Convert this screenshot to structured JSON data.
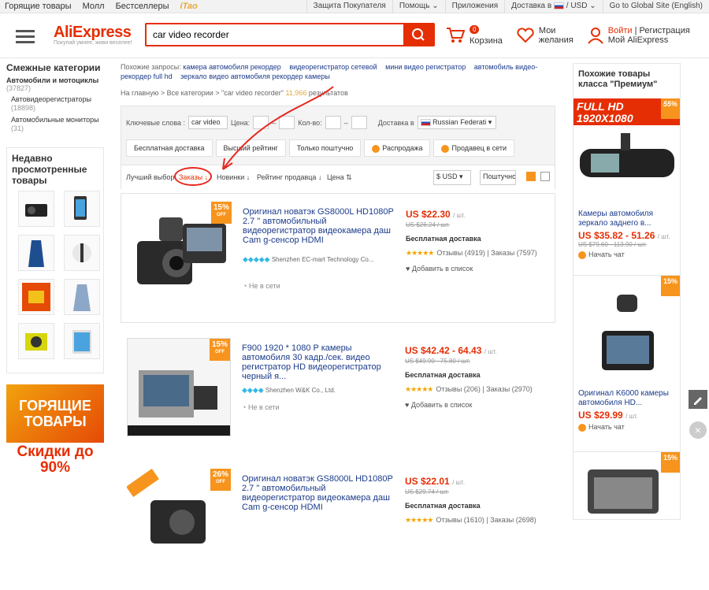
{
  "topbar": {
    "left": [
      "Горящие товары",
      "Молл",
      "Бестселлеры",
      "iTao"
    ],
    "right": [
      "Защита Покупателя",
      "Помощь",
      "Приложения",
      "Доставка в",
      "/ USD",
      "Go to Global Site (English)"
    ]
  },
  "header": {
    "logo": "AliExpress",
    "tagline": "Покупай умнее, живи веселее!",
    "search_value": "car video recorder",
    "cart_label": "Корзина",
    "cart_count": "0",
    "wish_label1": "Мои",
    "wish_label2": "желания",
    "login": "Войти",
    "register": "Регистрация",
    "my": "Мой AliExpress"
  },
  "left": {
    "related_title": "Смежные категории",
    "cat": "Автомобили и мотоциклы",
    "cat_count": "(37827)",
    "sub1": "Автовидеорегистраторы",
    "sub1_count": "(18898)",
    "sub2": "Автомобильные мониторы",
    "sub2_count": "(31)",
    "recent_title": "Недавно просмотренные товары",
    "hot_title": "ГОРЯЩИЕ ТОВАРЫ",
    "hot_sub": "Скидки до 90%"
  },
  "main": {
    "related_prefix": "Похожие запросы:",
    "related": [
      "камера автомобиля рекордер",
      "видеорегистратор сетевой",
      "мини видео регистратор",
      "автомобиль видео-рекордер full hd",
      "зеркало видео автомобиля рекордер камеры"
    ],
    "crumb1": "На главную",
    "crumb2": "Все категории",
    "crumb3": "\"car video recorder\"",
    "result_count": "11,966",
    "result_label": "результатов",
    "kw_label": "Ключевые слова :",
    "kw_value": "car video re",
    "price_label": "Цена:",
    "qty_label": "Кол-во:",
    "ship_label": "Доставка в",
    "ship_country": "Russian Federati",
    "chips": [
      "Бесплатная доставка",
      "Высший рейтинг",
      "Только поштучно",
      "Распродажа",
      "Продавец в сети"
    ],
    "sort": [
      "Лучший выбор",
      "Заказы",
      "Новинки",
      "Рейтинг продавца",
      "Цена"
    ],
    "currency": "$ USD",
    "per": "Поштучно"
  },
  "products": [
    {
      "discount": "15%",
      "off": "OFF",
      "title": "Оригинал новатэк GS8000L HD1080P 2.7 \" автомобильный видеорегистратор видеокамера даш Cam g-сенсор HDMI",
      "seller": "Shenzhen EC-mart Technology Co...",
      "online": "Не в сети",
      "price": "US $22.30",
      "per": "/ шт.",
      "old": "US $26.24 / шт.",
      "ship": "Бесплатная доставка",
      "reviews": "Отзывы (4919)",
      "orders": "Заказы (7597)",
      "wish": "Добавить в список"
    },
    {
      "discount": "15%",
      "off": "OFF",
      "title": "F900 1920 * 1080 P камеры автомобиля 30 кадр./сек. видео регистратор HD видеорегистратор черный я...",
      "seller": "Shenzhen W&K Co., Ltd.",
      "online": "Не в сети",
      "price": "US $42.42 - 64.43",
      "per": "/ шт.",
      "old": "US $49.90 - 75.80 / шт.",
      "ship": "Бесплатная доставка",
      "reviews": "Отзывы (206)",
      "orders": "Заказы (2970)",
      "wish": "Добавить в список"
    },
    {
      "discount": "26%",
      "off": "OFF",
      "title": "Оригинал новатэк GS8000L HD1080P 2.7 \" автомобильный видеорегистратор видеокамера даш Cam g-сенсор HDMI",
      "seller": "",
      "online": "",
      "price": "US $22.01",
      "per": "/ шт.",
      "old": "US $29.74 / шт.",
      "ship": "Бесплатная доставка",
      "reviews": "Отзывы (1610)",
      "orders": "Заказы (2698)",
      "wish": ""
    }
  ],
  "right": {
    "title": "Похожие товары класса \"Премиум\"",
    "items": [
      {
        "banner1": "FULL HD",
        "banner2": "1920X1080",
        "discount": "55%",
        "title": "Камеры автомобиля зеркало заднего в...",
        "price": "US $35.82 - 51.26",
        "per": "/ шт.",
        "old": "US $79.60 - 113.90 / шт.",
        "chat": "Начать чат"
      },
      {
        "discount": "15%",
        "title": "Оригинал K6000 камеры автомобиля HD...",
        "price": "US $29.99",
        "per": "/ шт.",
        "chat": "Начать чат"
      },
      {
        "discount": "15%"
      }
    ]
  },
  "colors": {
    "accent": "#e62e04",
    "discount": "#f7941d",
    "link": "#1a3a8a"
  }
}
